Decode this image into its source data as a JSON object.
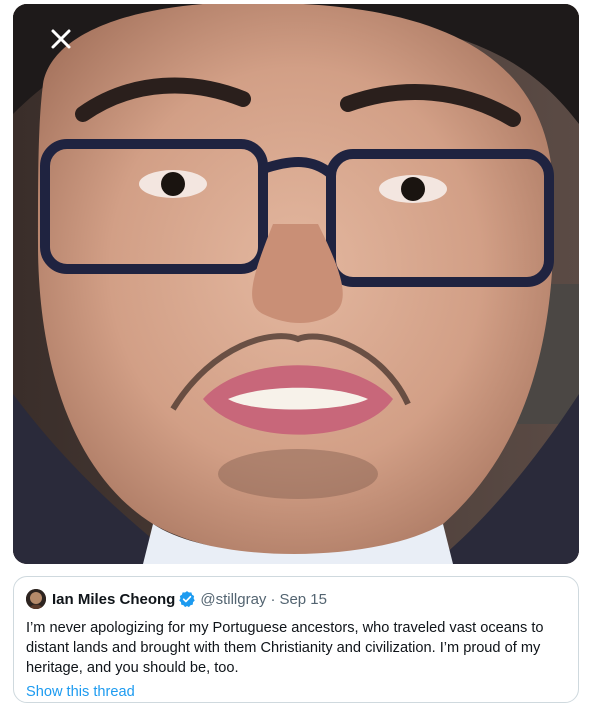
{
  "media": {
    "alt": "Photo",
    "close_icon": "close-icon"
  },
  "quote": {
    "author_name": "Ian Miles Cheong",
    "verified_icon": "verified-badge-icon",
    "handle": "@stillgray",
    "separator": "·",
    "date": "Sep 15",
    "text": "I’m never apologizing for my Portuguese ancestors, who traveled vast oceans to distant lands and brought with them Christianity and civilization. I’m proud of my heritage, and you should be, too.",
    "show_thread": "Show this thread"
  },
  "colors": {
    "link": "#1d9bf0",
    "border": "#cfd9de",
    "secondary_text": "#536471",
    "primary_text": "#0f1419"
  }
}
